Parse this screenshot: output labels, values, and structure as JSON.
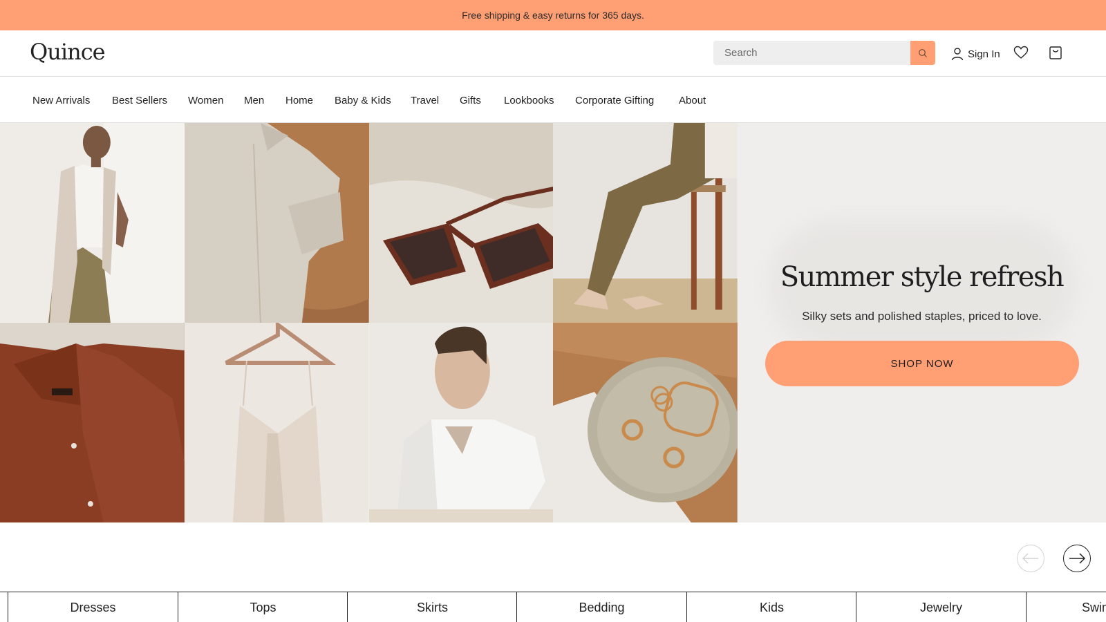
{
  "promo": {
    "text": "Free shipping & easy returns for 365 days."
  },
  "header": {
    "logo": "Quince",
    "search_placeholder": "Search",
    "signin_label": "Sign In"
  },
  "nav": {
    "items": [
      "New Arrivals",
      "Best Sellers",
      "Women",
      "Men",
      "Home",
      "Baby & Kids",
      "Travel",
      "Gifts",
      "Lookbooks",
      "Corporate Gifting",
      "About"
    ]
  },
  "hero": {
    "title": "Summer style refresh",
    "subtitle": "Silky sets and polished staples, priced to love.",
    "cta": "SHOP NOW"
  },
  "categories": [
    "Dresses",
    "Tops",
    "Skirts",
    "Bedding",
    "Kids",
    "Jewelry",
    "Swim"
  ],
  "colors": {
    "accent": "#ff9f73",
    "panel": "#efeeec"
  }
}
